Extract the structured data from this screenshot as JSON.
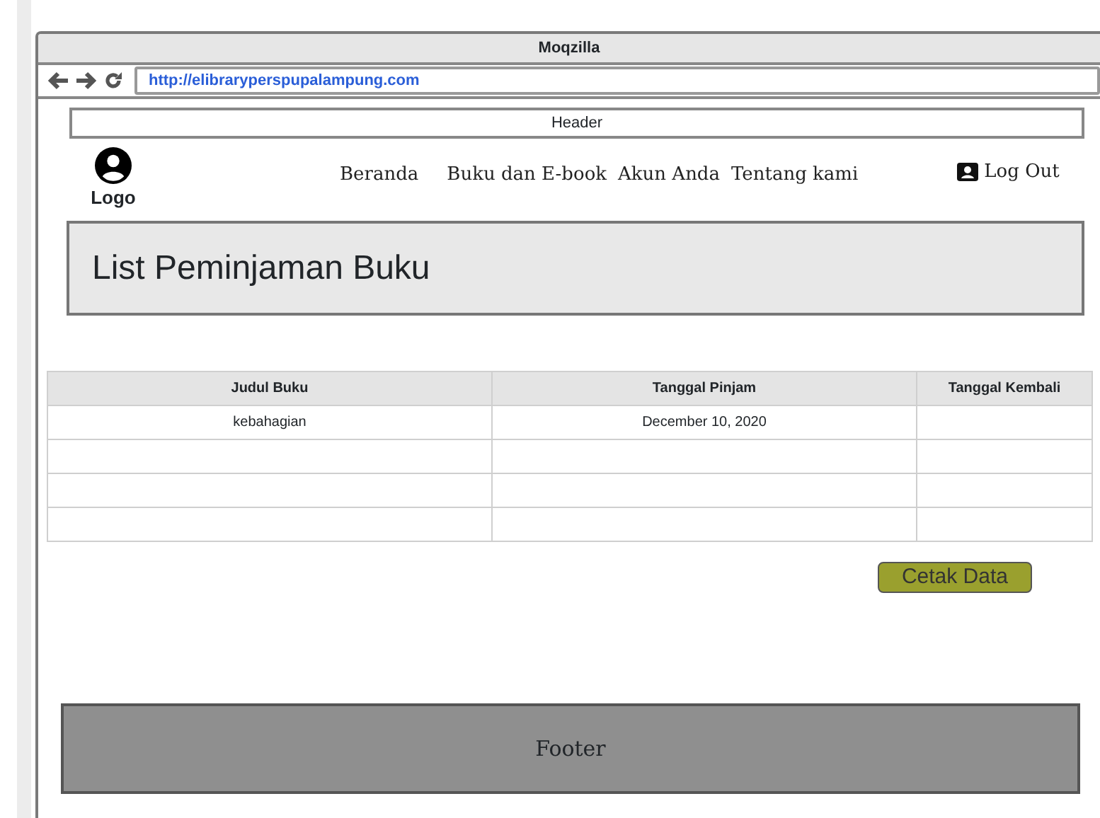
{
  "window": {
    "title": "Moqzilla"
  },
  "toolbar": {
    "url": "http://elibraryperspupalampung.com"
  },
  "header_label": "Header",
  "logo": {
    "label": "Logo"
  },
  "nav": {
    "items": [
      "Beranda",
      "Buku dan E-book",
      "Akun Anda",
      "Tentang kami"
    ],
    "logout": "Log Out"
  },
  "page_title": "List Peminjaman Buku",
  "table": {
    "columns": [
      "Judul Buku",
      "Tanggal Pinjam",
      "Tanggal Kembali"
    ],
    "rows": [
      {
        "cells": [
          "kebahagian",
          "December 10, 2020"
        ]
      },
      {},
      {},
      {}
    ]
  },
  "print_button": "Cetak Data",
  "footer": "Footer"
}
